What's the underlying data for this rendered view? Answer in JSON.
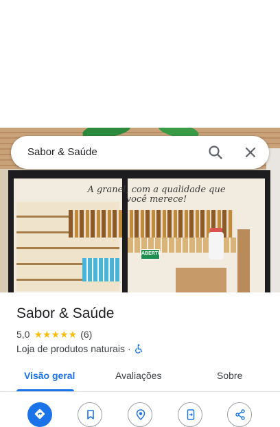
{
  "search": {
    "query": "Sabor & Saúde"
  },
  "photo": {
    "glass_text_line1": "A granel, com a qualidade que você merece!",
    "open_sign": "ABERTO"
  },
  "place": {
    "name": "Sabor & Saúde",
    "rating": "5,0",
    "stars": "★★★★★",
    "review_count": "(6)",
    "category": "Loja de produtos naturais",
    "separator": "·"
  },
  "tabs": [
    {
      "label": "Visão geral",
      "active": true
    },
    {
      "label": "Avaliações",
      "active": false
    },
    {
      "label": "Sobre",
      "active": false
    }
  ],
  "actions": [
    {
      "icon": "directions-icon"
    },
    {
      "icon": "bookmark-icon"
    },
    {
      "icon": "nearby-icon"
    },
    {
      "icon": "send-to-phone-icon"
    },
    {
      "icon": "share-icon"
    }
  ],
  "colors": {
    "accent": "#1a73e8",
    "star": "#fbbc04",
    "text": "#202124",
    "secondary_text": "#3c4043"
  }
}
